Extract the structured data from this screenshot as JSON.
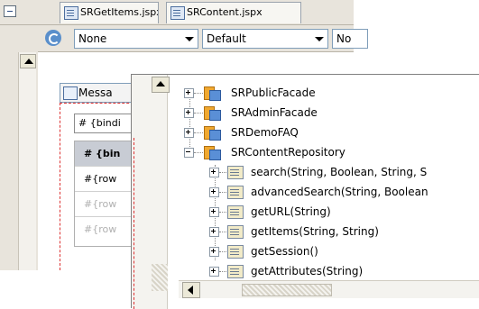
{
  "editor": {
    "tabs": [
      {
        "label": "SRGetItems.jspx"
      },
      {
        "label": "SRContent.jspx"
      }
    ],
    "toolbar": {
      "combo1": "None",
      "combo2": "Default",
      "combo3": "No"
    },
    "canvas": {
      "message_tab": "Messa",
      "binding_field": "# {bindi",
      "table_header": "# {bin",
      "rows": [
        "#{row",
        "#{row",
        "#{row"
      ]
    }
  },
  "tree": {
    "packages": [
      {
        "label": "SRPublicFacade"
      },
      {
        "label": "SRAdminFacade"
      },
      {
        "label": "SRDemoFAQ"
      },
      {
        "label": "SRContentRepository"
      }
    ],
    "methods": [
      {
        "label": "search(String, Boolean, String, S"
      },
      {
        "label": "advancedSearch(String, Boolean"
      },
      {
        "label": "getURL(String)"
      },
      {
        "label": "getItems(String, String)"
      },
      {
        "label": "getSession()"
      },
      {
        "label": "getAttributes(String)"
      }
    ]
  },
  "colors": {
    "chrome": "#e8e4dc",
    "selection_dash": "#dd3333",
    "package_orange": "#f0a830",
    "package_blue": "#5a8fd6"
  },
  "icons": [
    "collapse-icon",
    "jspx-file-icon",
    "refresh-icon",
    "dropdown-arrow-icon",
    "package-icon",
    "method-icon",
    "expand-icon",
    "collapse-node-icon",
    "scroll-up-icon",
    "scroll-left-icon"
  ]
}
